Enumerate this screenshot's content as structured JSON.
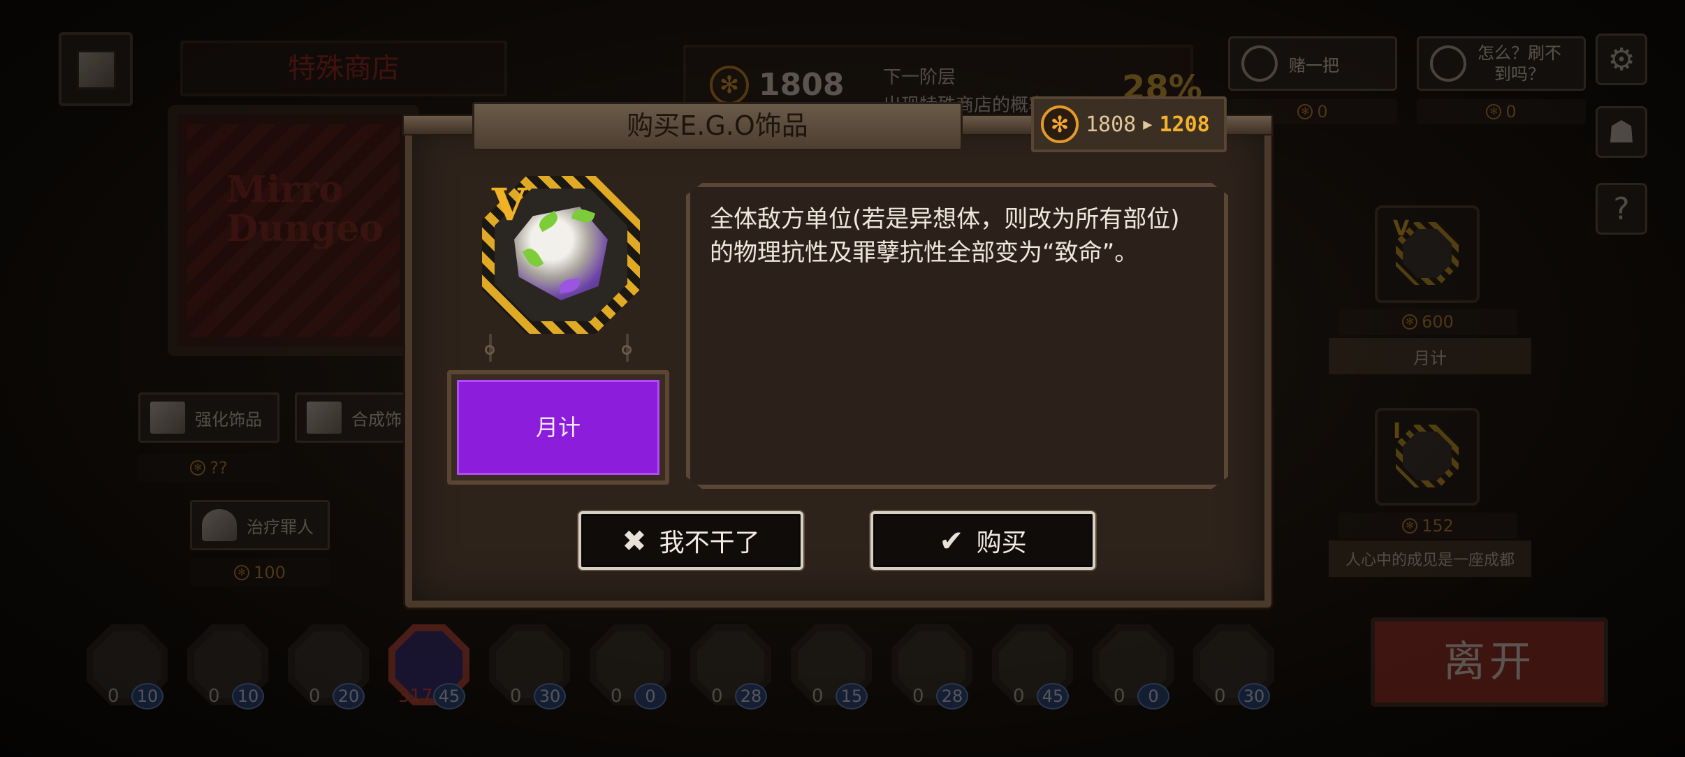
{
  "background": {
    "store_title": "特殊商店",
    "poster_text": [
      "Mirro",
      "Dungeo"
    ],
    "coins": "1808",
    "next_floor_label": "下一阶层",
    "next_floor_sub": "出现特殊商店的概率",
    "next_floor_percent": "28%",
    "gamble_button": "赌一把",
    "gamble_cost": "0",
    "refresh_button_line1": "怎么？刷不",
    "refresh_button_line2": "到吗？",
    "refresh_cost": "0",
    "shop_actions": [
      {
        "label": "强化饰品",
        "price": "??"
      },
      {
        "label": "合成饰品",
        "price": ""
      },
      {
        "label": "治疗罪人",
        "price": "100"
      }
    ],
    "shop_items": [
      {
        "rank": "V",
        "price": "600",
        "name": "月计"
      },
      {
        "rank": "I",
        "price": "152",
        "name": "人心中的成见是一座成都"
      }
    ],
    "leave_button": "离开",
    "roster": [
      {
        "level": "0",
        "sp": "10"
      },
      {
        "level": "0",
        "sp": "10"
      },
      {
        "level": "0",
        "sp": "20"
      },
      {
        "level": "317",
        "sp": "45",
        "active": true
      },
      {
        "level": "0",
        "sp": "30"
      },
      {
        "level": "0",
        "sp": "0"
      },
      {
        "level": "0",
        "sp": "28"
      },
      {
        "level": "0",
        "sp": "15"
      },
      {
        "level": "0",
        "sp": "28"
      },
      {
        "level": "0",
        "sp": "45"
      },
      {
        "level": "0",
        "sp": "0"
      },
      {
        "level": "0",
        "sp": "30"
      }
    ]
  },
  "modal": {
    "title": "购买E.G.O饰品",
    "cost_before": "1808",
    "cost_arrow": "▶",
    "cost_after": "1208",
    "item_rank": "V",
    "sin_label": "月计",
    "sin_color": "#8c1ddb",
    "description": "全体敌方单位(若是异想体，则改为所有部位)的物理抗性及罪孽抗性全部变为“致命”。",
    "cancel_label": "我不干了",
    "buy_label": "购买"
  },
  "icons": {
    "coin": "coin-icon",
    "settings": "gear-icon",
    "profile": "person-icon",
    "help": "question-icon",
    "cancel": "close-icon",
    "confirm": "check-icon"
  },
  "colors": {
    "accent_gold": "#f1b224",
    "leave_red": "#a5342b",
    "sin_purple": "#8c1ddb"
  }
}
